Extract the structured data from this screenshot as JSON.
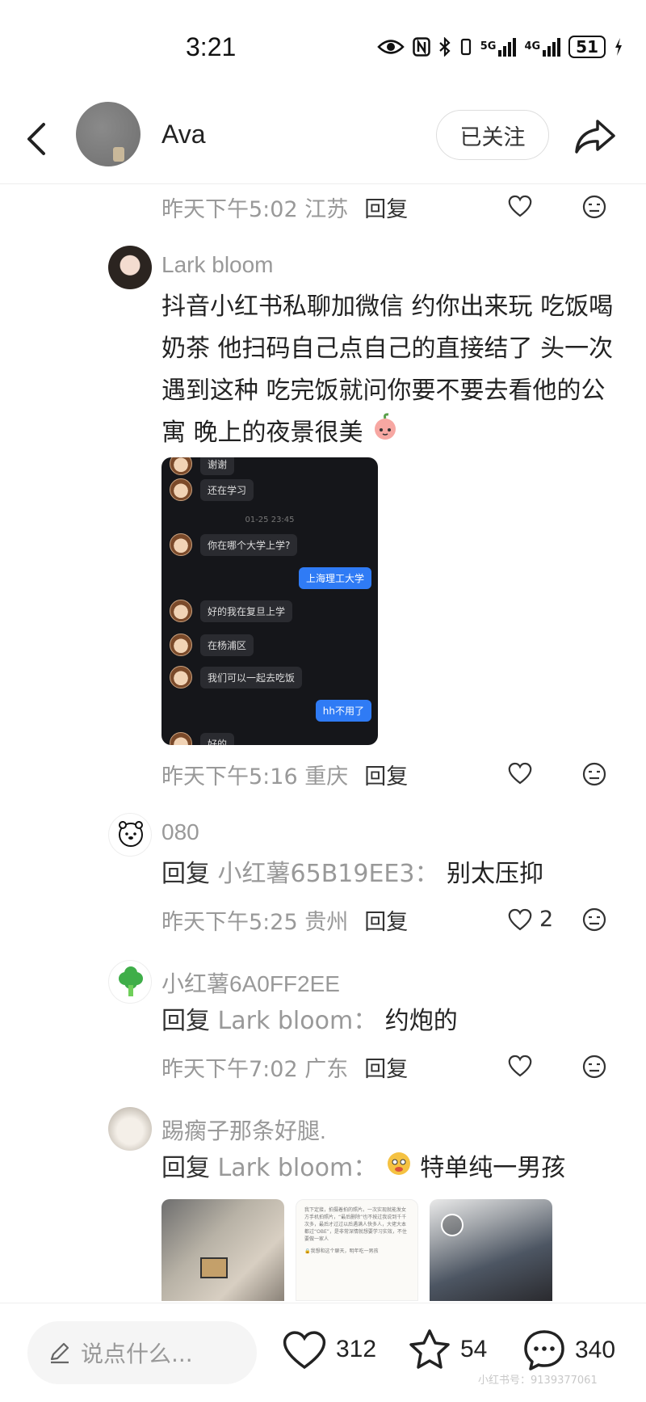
{
  "status_bar": {
    "time": "3:21",
    "net_5g": "5G",
    "net_4g": "4G",
    "battery": "51"
  },
  "header": {
    "author": "Ava",
    "follow_label": "已关注"
  },
  "comments": [
    {
      "meta": {
        "time": "昨天下午5:02 江苏",
        "reply": "回复"
      }
    },
    {
      "name": "Lark bloom",
      "text": "抖音小红书私聊加微信 约你出来玩 吃饭喝奶茶 他扫码自己点自己的直接结了 头一次遇到这种 吃完饭就问你要不要去看他的公寓 晚上的夜景很美",
      "meta": {
        "time": "昨天下午5:16 重庆",
        "reply": "回复"
      }
    },
    {
      "name": "080",
      "reply_prefix": "回复",
      "reply_target": "小红薯65B19EE3：",
      "text": "别太压抑",
      "meta": {
        "time": "昨天下午5:25 贵州",
        "reply": "回复",
        "likes": "2"
      }
    },
    {
      "name": "小红薯6A0FF2EE",
      "reply_prefix": "回复",
      "reply_target": "Lark bloom：",
      "text": "约炮的",
      "meta": {
        "time": "昨天下午7:02 广东",
        "reply": "回复"
      }
    },
    {
      "name": "踢瘸子那条好腿.",
      "reply_prefix": "回复",
      "reply_target": "Lark bloom：",
      "text": "特单纯一男孩"
    }
  ],
  "chat_screenshot": {
    "messages": [
      {
        "side": "left",
        "text": "谢谢"
      },
      {
        "side": "left",
        "text": "还在学习"
      },
      {
        "side": "stamp",
        "text": "01-25 23:45"
      },
      {
        "side": "left",
        "text": "你在哪个大学上学?"
      },
      {
        "side": "right",
        "text": "上海理工大学"
      },
      {
        "side": "left",
        "text": "好的我在复旦上学"
      },
      {
        "side": "left",
        "text": "在杨浦区"
      },
      {
        "side": "left",
        "text": "我们可以一起去吃饭"
      },
      {
        "side": "right",
        "text": "hh不用了"
      },
      {
        "side": "left",
        "text": "好的"
      }
    ]
  },
  "thumb_note": {
    "text": "我下定接，拍摄着拍的照片。一次实现就能发女方手机拍照片，“最后删除”也不按过我说到千千次多，最后才过过以后遇满人快多人，大佬大本都过“OBE”，是非常深情就想要学习实效，不住要做一家人",
    "caption": "🔒我想和这个聊天，明年吃一男孩"
  },
  "bottom_bar": {
    "input_placeholder": "说点什么...",
    "likes": "312",
    "stars": "54",
    "comments": "340",
    "watermark": "小红书号：9139377061"
  }
}
